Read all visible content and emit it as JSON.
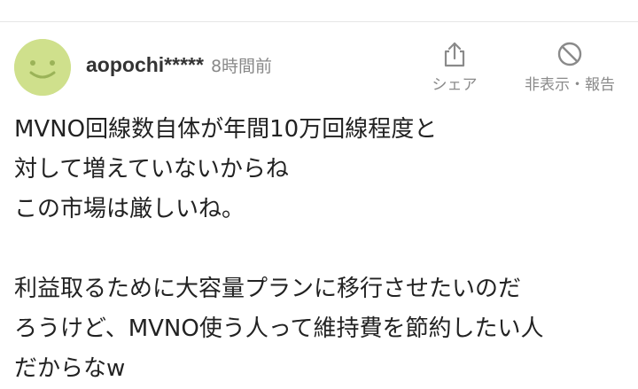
{
  "comment": {
    "user": {
      "name": "aopochi*****",
      "time": "8時間前",
      "avatar_icon": "smiley-face-icon",
      "avatar_color": "#cfe08c"
    },
    "actions": {
      "share": {
        "label": "シェア",
        "icon": "share-icon"
      },
      "report": {
        "label": "非表示・報告",
        "icon": "hide-report-icon"
      }
    },
    "lines": [
      "MVNO回線数自体が年間10万回線程度と",
      "対して増えていないからね",
      "この市場は厳しいね。",
      "",
      "利益取るために大容量プランに移行させたいのだ",
      "ろうけど、MVNO使う人って維持費を節約したい人",
      "だからなw"
    ]
  }
}
